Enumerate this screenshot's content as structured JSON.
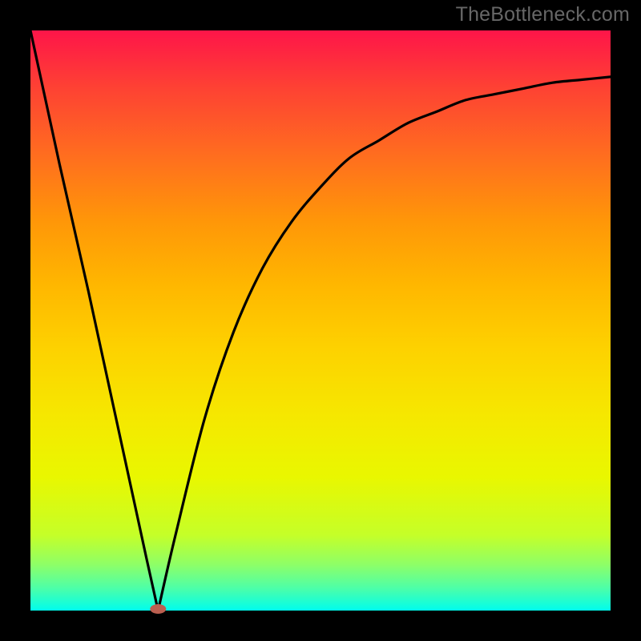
{
  "watermark": "TheBottleneck.com",
  "colors": {
    "frame": "#000000",
    "gradient_top": "#fe1549",
    "gradient_bottom": "#00fded",
    "curve": "#000000",
    "marker": "#bb5f50"
  },
  "chart_data": {
    "type": "line",
    "title": "",
    "xlabel": "",
    "ylabel": "",
    "xlim": [
      0,
      100
    ],
    "ylim": [
      0,
      100
    ],
    "x": [
      0,
      5,
      10,
      15,
      20,
      22,
      25,
      30,
      35,
      40,
      45,
      50,
      55,
      60,
      65,
      70,
      75,
      80,
      85,
      90,
      95,
      100
    ],
    "values": [
      100,
      77,
      55,
      32,
      9,
      0,
      13,
      33,
      48,
      59,
      67,
      73,
      78,
      81,
      84,
      86,
      88,
      89,
      90,
      91,
      91.5,
      92
    ],
    "minimum_point": {
      "x": 22,
      "y": 0
    },
    "annotations": []
  }
}
